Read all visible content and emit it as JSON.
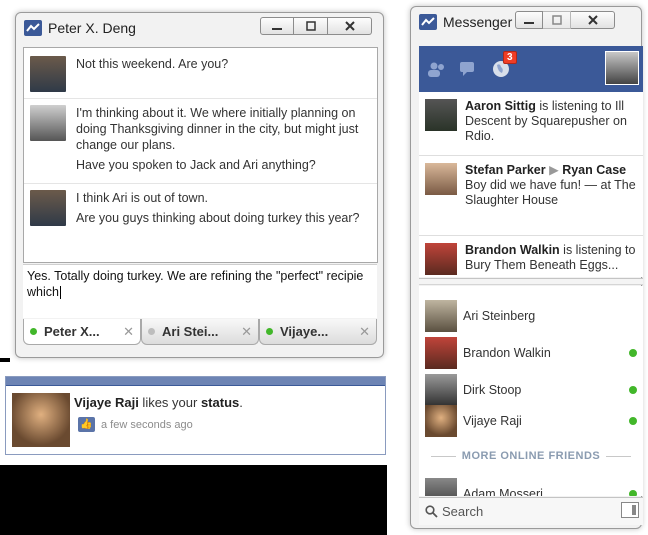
{
  "chat": {
    "title": "Peter X. Deng",
    "messages": [
      {
        "lines": [
          "Not this weekend. Are you?"
        ]
      },
      {
        "lines": [
          "I'm thinking about it. We where initially planning on doing Thanksgiving dinner in the city, but might just change our plans.",
          "Have you spoken to Jack and Ari anything?"
        ]
      },
      {
        "lines": [
          "I think Ari is out of town.",
          "Are you guys thinking about doing turkey this year?"
        ]
      }
    ],
    "compose_text": "Yes. Totally doing turkey. We are refining the \"perfect\" recipie which",
    "tabs": [
      {
        "label": "Peter X...",
        "status": "online"
      },
      {
        "label": "Ari Stei...",
        "status": "idle"
      },
      {
        "label": "Vijaye...",
        "status": "online"
      }
    ]
  },
  "notification": {
    "actor": "Vijaye Raji",
    "middle": " likes your ",
    "object": "status",
    "end": ".",
    "time": "a few seconds ago"
  },
  "messenger": {
    "title": "Messenger",
    "notification_count": "3",
    "ticker": [
      {
        "name": "Aaron Sittig",
        "text": " is listening to Ill Descent by Squarepusher on Rdio."
      },
      {
        "name": "Stefan Parker",
        "arrow": "▶",
        "name2": "Ryan Case",
        "text": " Boy did we have fun! — at The Slaughter House"
      },
      {
        "name": "Brandon Walkin",
        "text": " is listening to Bury Them Beneath Eggs..."
      }
    ],
    "friends": [
      {
        "name": "Ari Steinberg",
        "online": false
      },
      {
        "name": "Brandon Walkin",
        "online": true
      },
      {
        "name": "Dirk Stoop",
        "online": true
      },
      {
        "name": "Vijaye Raji",
        "online": true
      }
    ],
    "more_label": "MORE ONLINE FRIENDS",
    "more_friends": [
      {
        "name": "Adam Mosseri",
        "online": true
      }
    ],
    "search_label": "Search"
  },
  "colors": {
    "brand": "#3b5998",
    "online": "#42b72a",
    "badge": "#f03d25"
  }
}
